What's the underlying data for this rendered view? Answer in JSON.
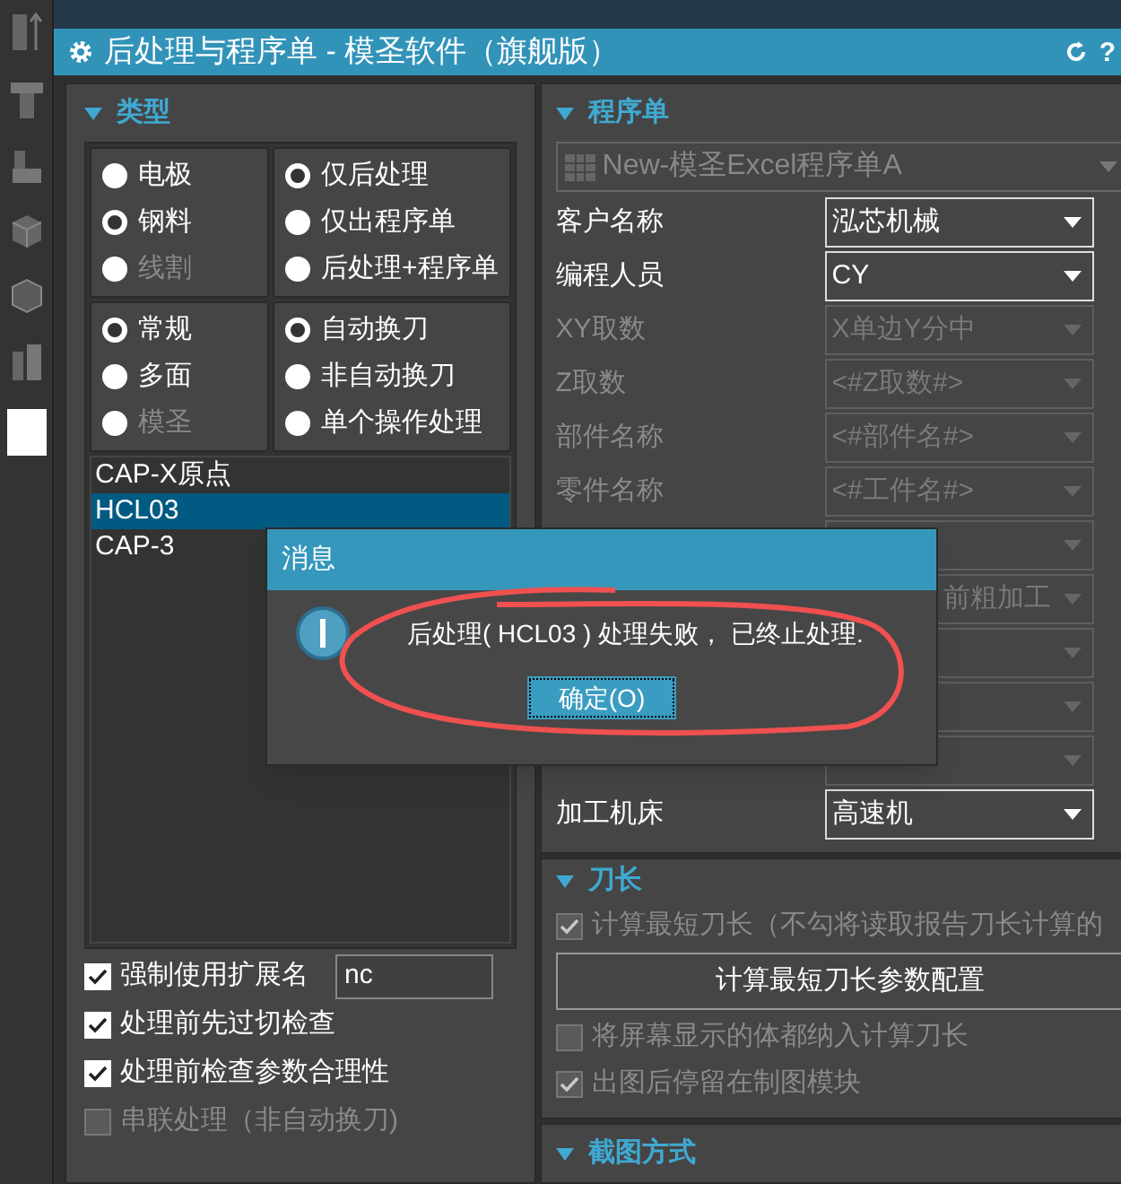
{
  "window": {
    "title": "后处理与程序单 - 模圣软件（旗舰版）",
    "help_glyph": "?"
  },
  "type_panel": {
    "title": "类型",
    "radio_groups": [
      [
        {
          "label": "电极",
          "selected": false,
          "disabled": false
        },
        {
          "label": "钢料",
          "selected": true,
          "disabled": false
        },
        {
          "label": "线割",
          "selected": false,
          "disabled": true
        }
      ],
      [
        {
          "label": "仅后处理",
          "selected": true,
          "disabled": false
        },
        {
          "label": "仅出程序单",
          "selected": false,
          "disabled": false
        },
        {
          "label": "后处理+程序单",
          "selected": false,
          "disabled": false
        }
      ],
      [
        {
          "label": "常规",
          "selected": true,
          "disabled": false
        },
        {
          "label": "多面",
          "selected": false,
          "disabled": false
        },
        {
          "label": "模圣",
          "selected": false,
          "disabled": true
        }
      ],
      [
        {
          "label": "自动换刀",
          "selected": true,
          "disabled": false
        },
        {
          "label": "非自动换刀",
          "selected": false,
          "disabled": false
        },
        {
          "label": "单个操作处理",
          "selected": false,
          "disabled": false
        }
      ]
    ],
    "list": [
      {
        "label": "CAP-X原点",
        "selected": false
      },
      {
        "label": "HCL03",
        "selected": true
      },
      {
        "label": "CAP-3",
        "selected": false
      }
    ],
    "options": [
      {
        "label": "强制使用扩展名",
        "checked": true,
        "disabled": false,
        "value": "nc"
      },
      {
        "label": "处理前先过切检查",
        "checked": true,
        "disabled": false
      },
      {
        "label": "处理前检查参数合理性",
        "checked": true,
        "disabled": false
      },
      {
        "label": "串联处理（非自动换刀)",
        "checked": false,
        "disabled": true
      }
    ]
  },
  "program_panel": {
    "title": "程序单",
    "template": "New-模圣Excel程序单A",
    "fields": [
      {
        "label": "客户名称",
        "value": "泓芯机械",
        "disabled": false
      },
      {
        "label": "编程人员",
        "value": "CY",
        "disabled": false
      },
      {
        "label": "XY取数",
        "value": "X单边Y分中",
        "disabled": true
      },
      {
        "label": "Z取数",
        "placeholder": "<#Z取数#>",
        "disabled": true
      },
      {
        "label": "部件名称",
        "placeholder": "<#部件名#>",
        "disabled": true
      },
      {
        "label": "零件名称",
        "placeholder": "<#工件名#>",
        "disabled": true
      },
      {
        "disabled": true
      },
      {
        "value": "前粗加工",
        "disabled": true
      },
      {
        "disabled": true
      },
      {
        "disabled": true
      },
      {
        "disabled": true
      },
      {
        "label": "加工机床",
        "value": "高速机",
        "disabled": false
      }
    ]
  },
  "tool_length_panel": {
    "title": "刀长",
    "items": [
      {
        "kind": "checkbox",
        "label": "计算最短刀长（不勾将读取报告刀长计算的",
        "checked": true,
        "disabled": true
      },
      {
        "kind": "button",
        "label": "计算最短刀长参数配置"
      },
      {
        "kind": "checkbox",
        "label": "将屏幕显示的体都纳入计算刀长",
        "checked": false,
        "disabled": true
      },
      {
        "kind": "checkbox",
        "label": "出图后停留在制图模块",
        "checked": true,
        "disabled": true
      }
    ]
  },
  "screenshot_panel": {
    "title": "截图方式"
  },
  "dialog": {
    "title": "消息",
    "message": "后处理( HCL03 ) 处理失败， 已终止处理.",
    "button": "确定(O)"
  }
}
